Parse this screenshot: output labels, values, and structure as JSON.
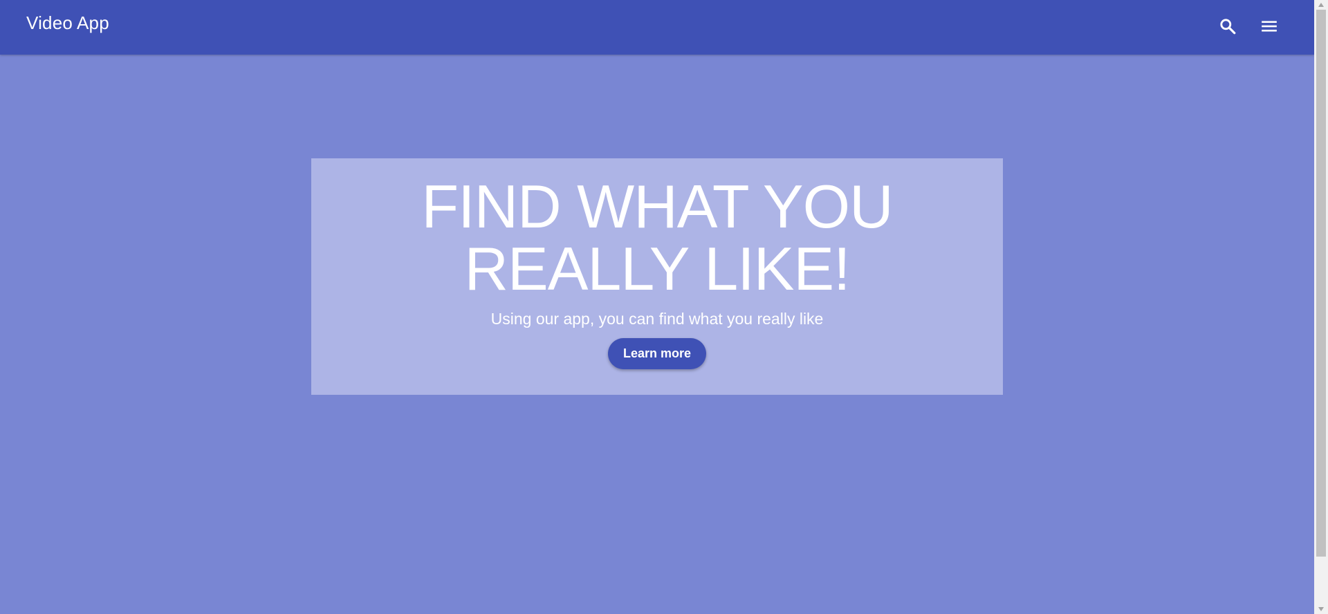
{
  "header": {
    "title": "Video App",
    "search_icon": "search-icon",
    "menu_icon": "menu-icon"
  },
  "hero": {
    "title_line1": "FIND WHAT YOU",
    "title_line2": "REALLY LIKE!",
    "subtitle": "Using our app, you can find what you really like",
    "button_label": "Learn more"
  },
  "colors": {
    "primary": "#3f51b5",
    "background": "#7986d3",
    "hero_panel": "#adb4e6",
    "text": "#ffffff"
  },
  "scrollbar": {
    "position_fraction": 0.0,
    "visible_fraction": 0.92
  }
}
